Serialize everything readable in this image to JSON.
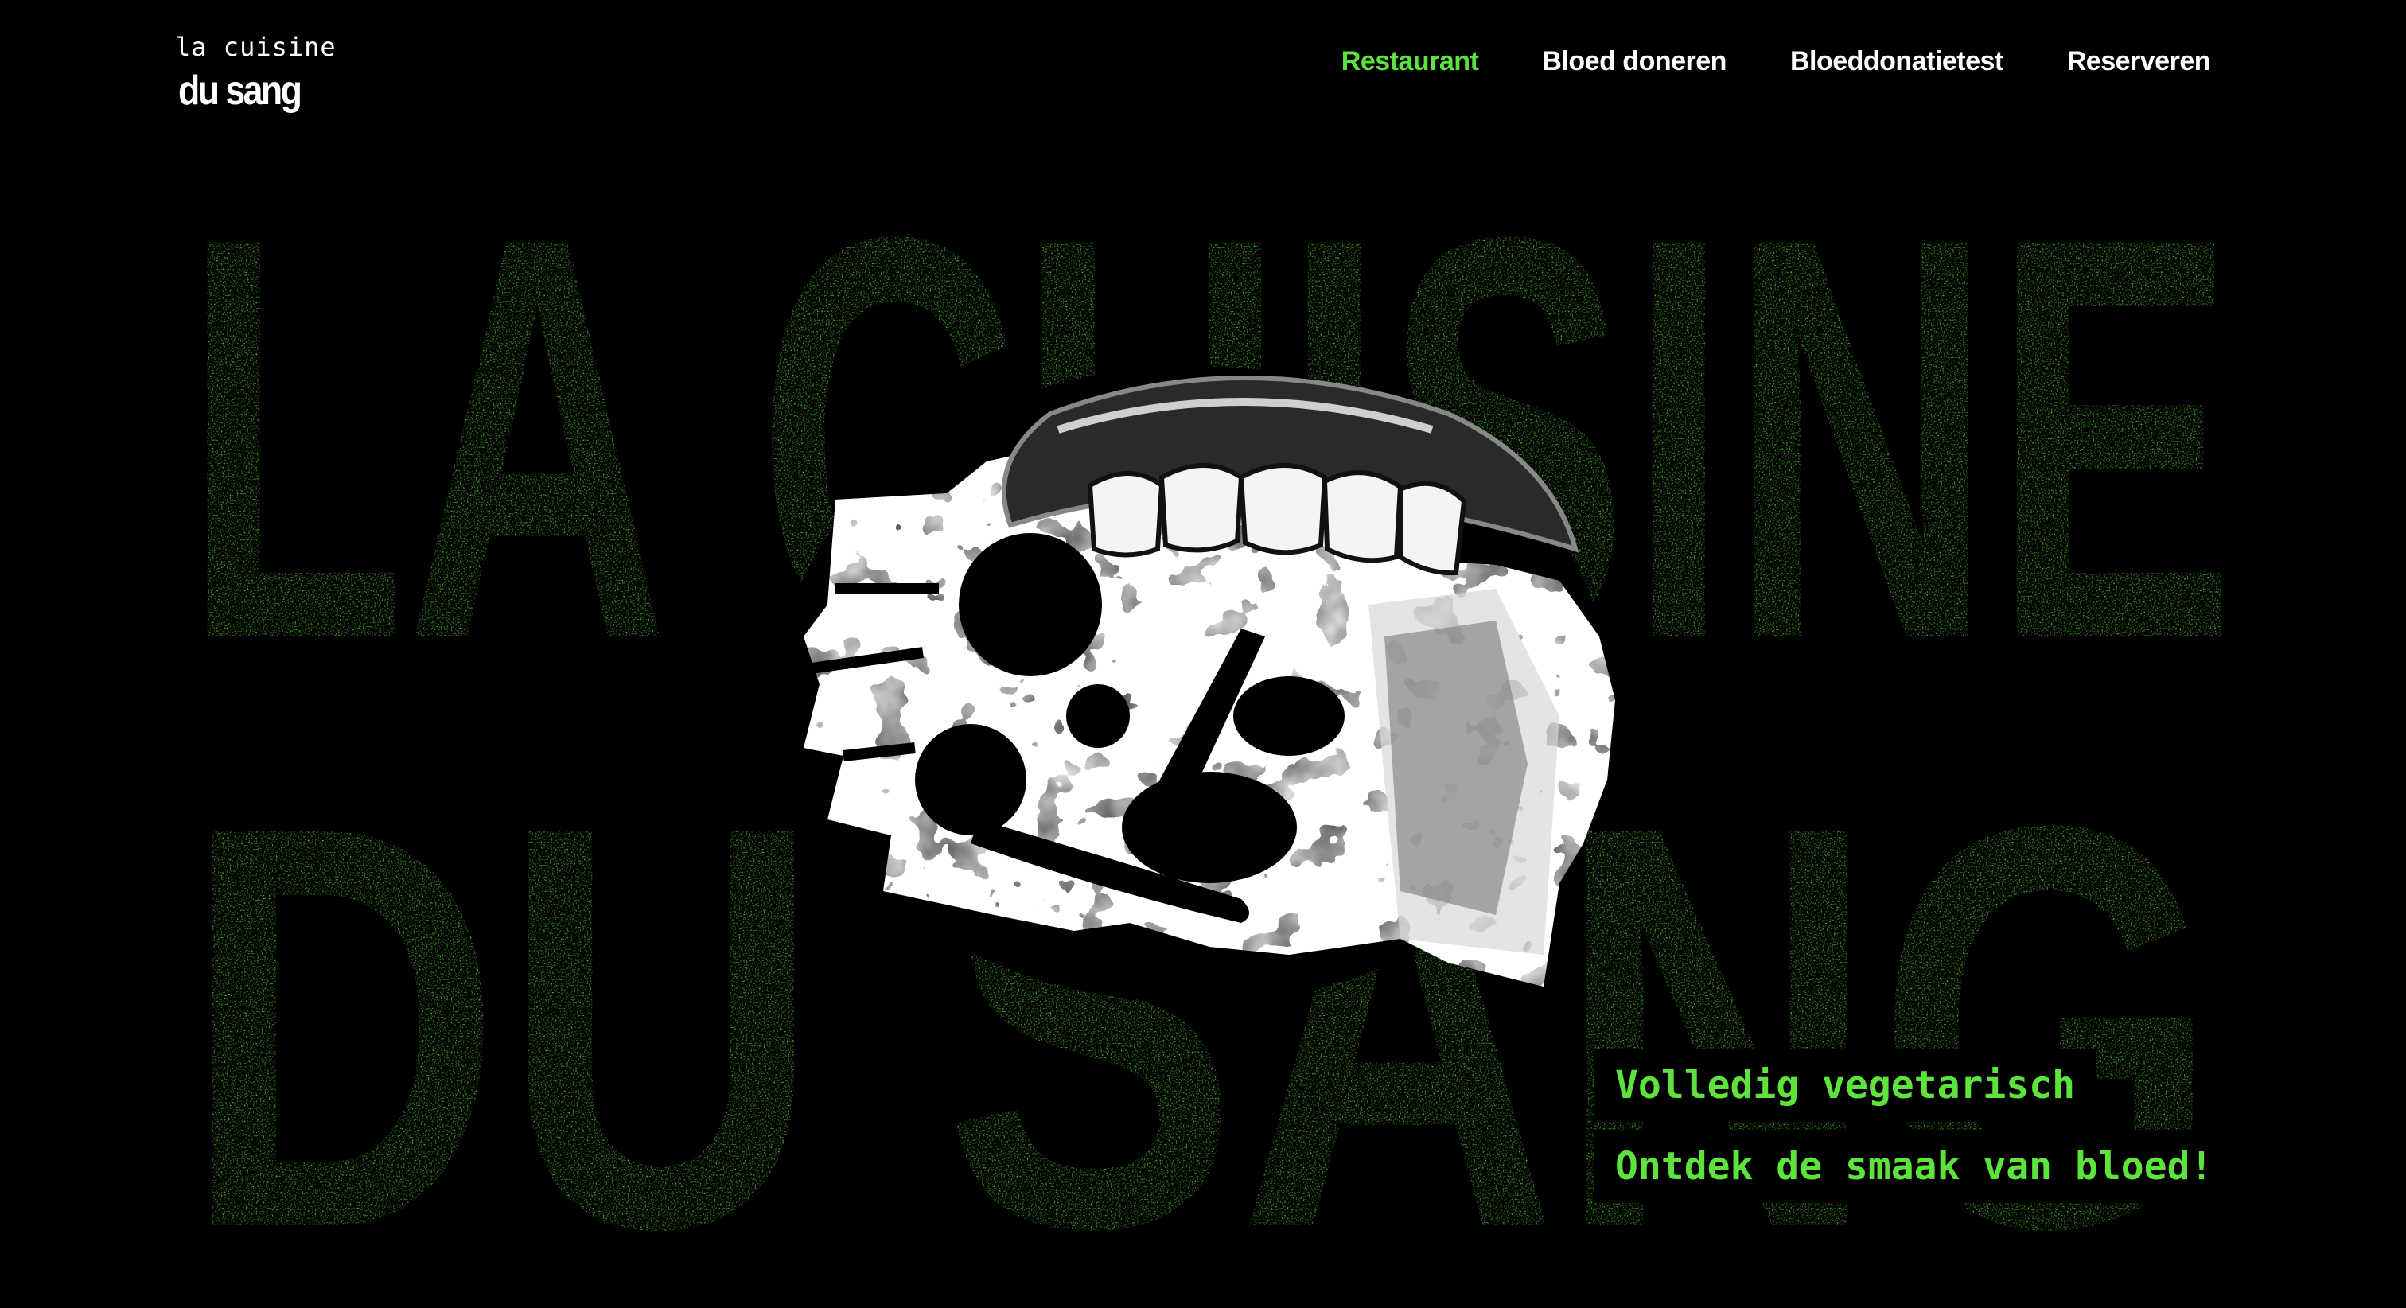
{
  "logo": {
    "line1": "la cuisine",
    "line2": "du sang"
  },
  "nav": {
    "items": [
      {
        "label": "Restaurant",
        "active": true
      },
      {
        "label": "Bloed doneren",
        "active": false
      },
      {
        "label": "Bloeddonatietest",
        "active": false
      },
      {
        "label": "Reserveren",
        "active": false
      }
    ]
  },
  "hero": {
    "title_line1": "LA CUISINE",
    "title_line2": "DU SANG",
    "image_description_icon": "mouth-eating-vegetables-collage"
  },
  "taglines": {
    "line1": "Volledig vegetarisch",
    "line2": "Ontdek de smaak van bloed!"
  },
  "colors": {
    "background": "#000000",
    "accent_green": "#5ee33c",
    "text_white": "#ffffff"
  }
}
